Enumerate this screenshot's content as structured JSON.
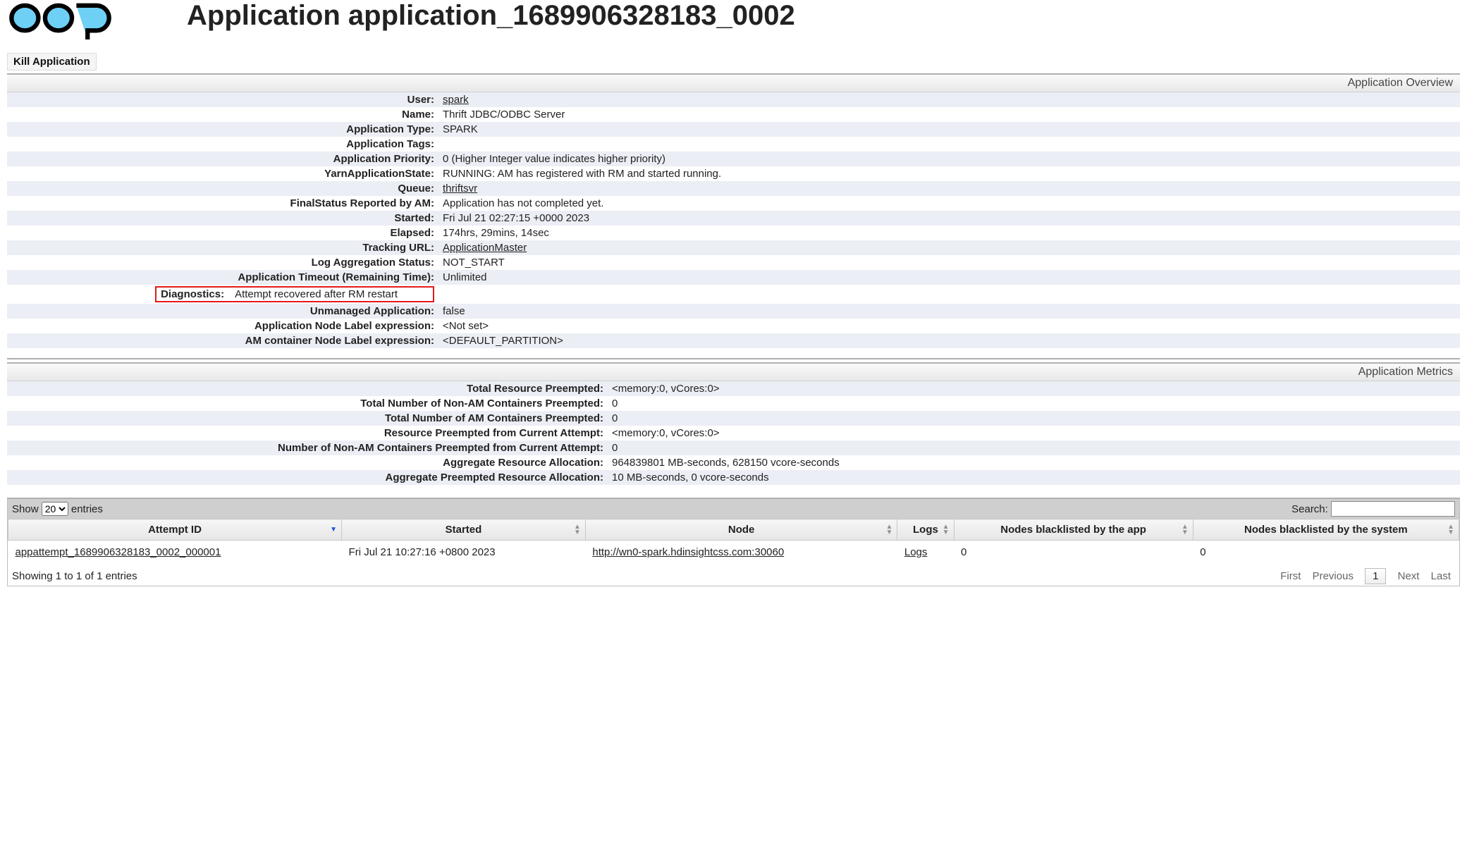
{
  "page_title": "Application application_1689906328183_0002",
  "kill_button_label": "Kill Application",
  "overview": {
    "header": "Application Overview",
    "rows": [
      {
        "k": "User:",
        "v": "spark",
        "link": true
      },
      {
        "k": "Name:",
        "v": "Thrift JDBC/ODBC Server",
        "link": false
      },
      {
        "k": "Application Type:",
        "v": "SPARK",
        "link": false
      },
      {
        "k": "Application Tags:",
        "v": "",
        "link": false
      },
      {
        "k": "Application Priority:",
        "v": "0 (Higher Integer value indicates higher priority)",
        "link": false
      },
      {
        "k": "YarnApplicationState:",
        "v": "RUNNING: AM has registered with RM and started running.",
        "link": false
      },
      {
        "k": "Queue:",
        "v": "thriftsvr",
        "link": true
      },
      {
        "k": "FinalStatus Reported by AM:",
        "v": "Application has not completed yet.",
        "link": false
      },
      {
        "k": "Started:",
        "v": "Fri Jul 21 02:27:15 +0000 2023",
        "link": false
      },
      {
        "k": "Elapsed:",
        "v": "174hrs, 29mins, 14sec",
        "link": false
      },
      {
        "k": "Tracking URL:",
        "v": "ApplicationMaster",
        "link": true
      },
      {
        "k": "Log Aggregation Status:",
        "v": "NOT_START",
        "link": false
      },
      {
        "k": "Application Timeout (Remaining Time):",
        "v": "Unlimited",
        "link": false
      },
      {
        "k": "Diagnostics:",
        "v": "Attempt recovered after RM restart",
        "link": false,
        "highlight": true
      },
      {
        "k": "Unmanaged Application:",
        "v": "false",
        "link": false
      },
      {
        "k": "Application Node Label expression:",
        "v": "<Not set>",
        "link": false
      },
      {
        "k": "AM container Node Label expression:",
        "v": "<DEFAULT_PARTITION>",
        "link": false
      }
    ]
  },
  "metrics": {
    "header": "Application Metrics",
    "rows": [
      {
        "k": "Total Resource Preempted:",
        "v": "<memory:0, vCores:0>"
      },
      {
        "k": "Total Number of Non-AM Containers Preempted:",
        "v": "0"
      },
      {
        "k": "Total Number of AM Containers Preempted:",
        "v": "0"
      },
      {
        "k": "Resource Preempted from Current Attempt:",
        "v": "<memory:0, vCores:0>"
      },
      {
        "k": "Number of Non-AM Containers Preempted from Current Attempt:",
        "v": "0"
      },
      {
        "k": "Aggregate Resource Allocation:",
        "v": "964839801 MB-seconds, 628150 vcore-seconds"
      },
      {
        "k": "Aggregate Preempted Resource Allocation:",
        "v": "10 MB-seconds, 0 vcore-seconds"
      }
    ]
  },
  "attempts": {
    "show_label_pre": "Show",
    "show_label_post": "entries",
    "show_value": "20",
    "search_label": "Search:",
    "columns": [
      "Attempt ID",
      "Started",
      "Node",
      "Logs",
      "Nodes blacklisted by the app",
      "Nodes blacklisted by the system"
    ],
    "sorted_col_index": 0,
    "rows": [
      {
        "attempt_id": "appattempt_1689906328183_0002_000001",
        "started": "Fri Jul 21 10:27:16 +0800 2023",
        "node": "http://wn0-spark.hdinsightcss.com:30060",
        "logs": "Logs",
        "bl_app": "0",
        "bl_sys": "0"
      }
    ],
    "info": "Showing 1 to 1 of 1 entries",
    "pager": {
      "first": "First",
      "prev": "Previous",
      "page": "1",
      "next": "Next",
      "last": "Last"
    }
  }
}
